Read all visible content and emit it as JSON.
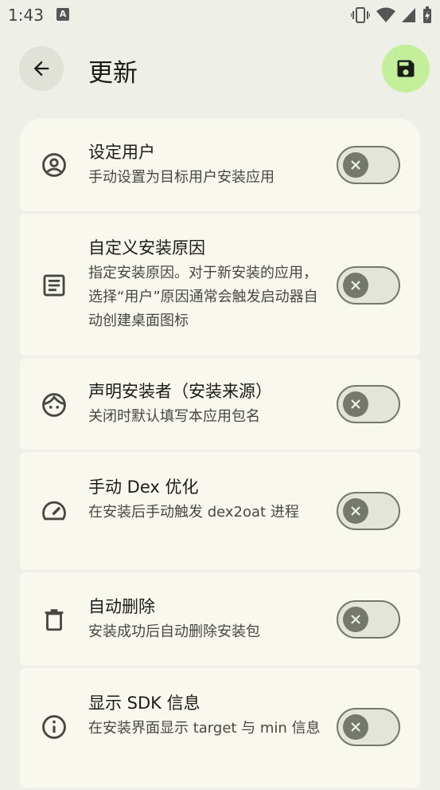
{
  "status_bar": {
    "time": "1:43",
    "notification_letter": "A"
  },
  "app_bar": {
    "title": "更新"
  },
  "settings": [
    {
      "icon": "account-circle-icon",
      "title": "设定用户",
      "description": "手动设置为目标用户安装应用",
      "enabled": false
    },
    {
      "icon": "article-icon",
      "title": "自定义安装原因",
      "description": "指定安装原因。对于新安装的应用，选择“用户”原因通常会触发启动器自动创建桌面图标",
      "enabled": false
    },
    {
      "icon": "face-icon",
      "title": "声明安装者（安装来源）",
      "description": "关闭时默认填写本应用包名",
      "enabled": false
    },
    {
      "icon": "speed-icon",
      "title": "手动 Dex 优化",
      "description": "在安装后手动触发 dex2oat 进程",
      "enabled": false
    },
    {
      "icon": "delete-icon",
      "title": "自动删除",
      "description": "安装成功后自动删除安装包",
      "enabled": false
    },
    {
      "icon": "info-icon",
      "title": "显示 SDK 信息",
      "description": "在安装界面显示 target 与 min 信息",
      "enabled": false
    }
  ]
}
